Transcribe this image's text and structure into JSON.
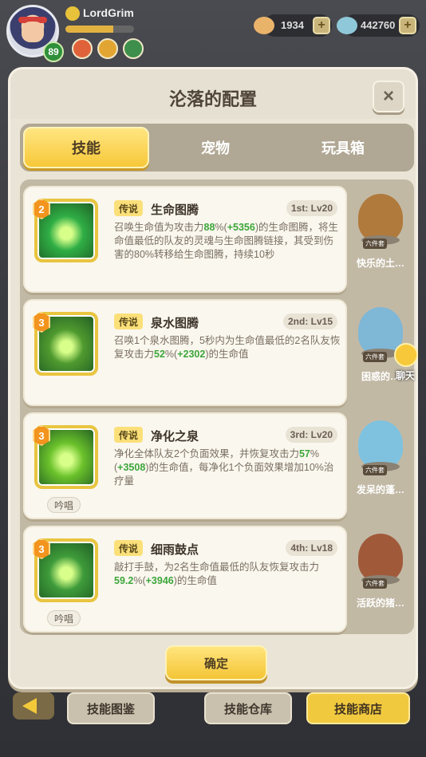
{
  "player": {
    "name": "LordGrim",
    "level": "89",
    "xp_fraction": 0.7
  },
  "currency": {
    "gold": "1934",
    "gems": "442760"
  },
  "dialog": {
    "title": "沦落的配置",
    "close_icon": "×",
    "tabs": [
      "技能",
      "宠物",
      "玩具箱"
    ],
    "active_tab": 0,
    "confirm_label": "确定"
  },
  "skills": [
    {
      "tier": "2",
      "rarity": "传说",
      "name": "生命图腾",
      "slot": "1st: Lv20",
      "desc": [
        {
          "t": "召唤生命值为攻击力"
        },
        {
          "t": "88",
          "hl": true
        },
        {
          "t": "%("
        },
        {
          "t": "+5356",
          "hl": true
        },
        {
          "t": ")的生命图腾，将生命值最低的队友的灵魂与生命图腾链接，其受到伤害的80%转移给生命图腾，持续10秒"
        }
      ],
      "chant": "",
      "icon_color": "#2fae45"
    },
    {
      "tier": "3",
      "rarity": "传说",
      "name": "泉水图腾",
      "slot": "2nd: Lv15",
      "desc": [
        {
          "t": "召唤1个泉水图腾，5秒内为生命值最低的2名队友恢复攻击力"
        },
        {
          "t": "52",
          "hl": true
        },
        {
          "t": "%("
        },
        {
          "t": "+2302",
          "hl": true
        },
        {
          "t": ")的生命值"
        }
      ],
      "chant": "",
      "icon_color": "#4f9a2f"
    },
    {
      "tier": "3",
      "rarity": "传说",
      "name": "净化之泉",
      "slot": "3rd: Lv20",
      "desc": [
        {
          "t": "净化全体队友2个负面效果，并恢复攻击力"
        },
        {
          "t": "57",
          "hl": true
        },
        {
          "t": "%("
        },
        {
          "t": "+3508",
          "hl": true
        },
        {
          "t": ")的生命值，每净化1个负面效果增加10%治疗量"
        }
      ],
      "chant": "吟唱",
      "icon_color": "#6bc22b"
    },
    {
      "tier": "3",
      "rarity": "传说",
      "name": "细雨鼓点",
      "slot": "4th: Lv18",
      "desc": [
        {
          "t": "敲打手鼓，为2名生命值最低的队友恢复攻击力"
        },
        {
          "t": "59.2",
          "hl": true
        },
        {
          "t": "%("
        },
        {
          "t": "+3946",
          "hl": true
        },
        {
          "t": ")的生命值"
        }
      ],
      "chant": "吟唱",
      "icon_color": "#3e9b3a"
    }
  ],
  "pets": [
    {
      "name": "快乐的土…",
      "tag": "六件套",
      "color": "#b07a3c"
    },
    {
      "name": "困惑的…",
      "tag": "六件套",
      "color": "#7fb7d6"
    },
    {
      "name": "发呆的蓬…",
      "tag": "六件套",
      "color": "#7fc2e0"
    },
    {
      "name": "活跃的猪…",
      "tag": "六件套",
      "color": "#a05a3a"
    }
  ],
  "chat": {
    "label": "聊天"
  },
  "bottom": {
    "skill_catalog": "技能图鉴",
    "skill_storage": "技能仓库",
    "skill_shop": "技能商店"
  }
}
